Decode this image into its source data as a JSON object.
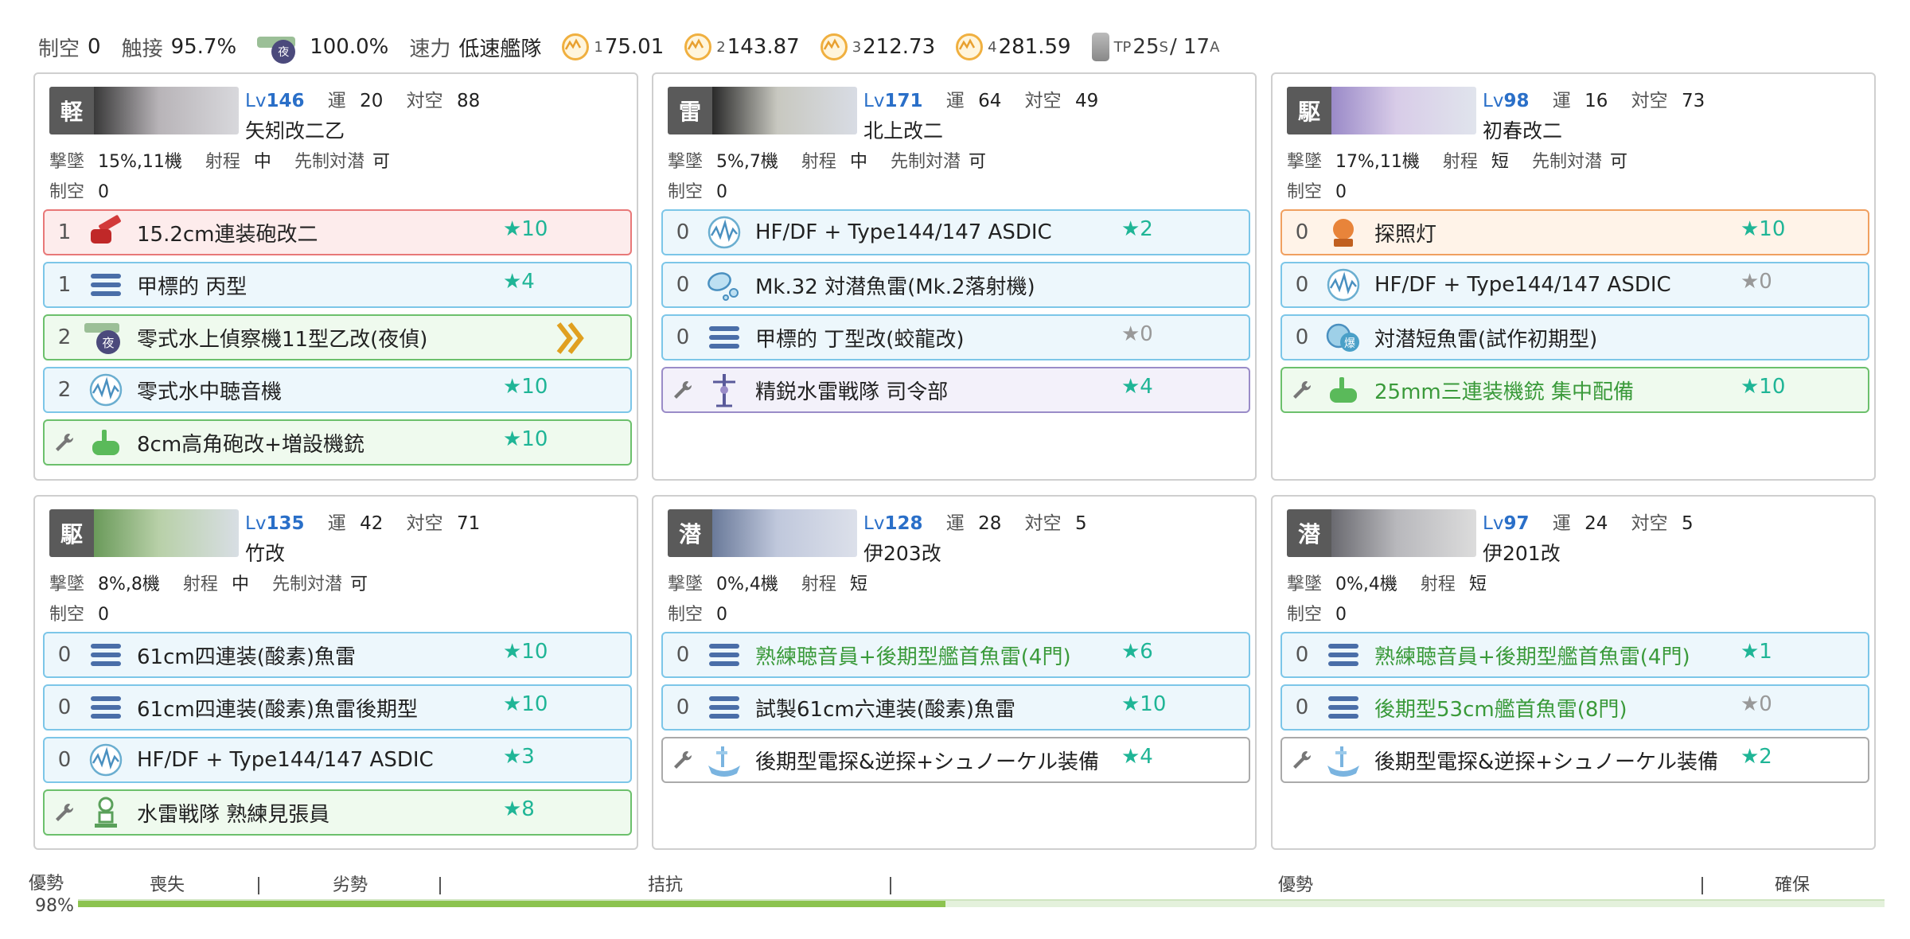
{
  "topbar": {
    "seiku_label": "制空",
    "seiku_value": "0",
    "shokusetsu_label": "触接",
    "shokusetsu_value": "95.7%",
    "night_icon": "夜",
    "night_value": "100.0%",
    "speed_label": "速力",
    "speed_value": "低速艦隊",
    "los": [
      {
        "sub": "1",
        "value": "75.01"
      },
      {
        "sub": "2",
        "value": "143.87"
      },
      {
        "sub": "3",
        "value": "212.73"
      },
      {
        "sub": "4",
        "value": "281.59"
      }
    ],
    "tp_sub": "TP",
    "tp_s": "25",
    "tp_s_sub": "S",
    "tp_sep": "/ 17",
    "tp_a_sub": "A"
  },
  "labels": {
    "luck": "運",
    "aa": "対空",
    "shootdown": "撃墜",
    "range": "射程",
    "oasw": "先制対潜",
    "air": "制空"
  },
  "ships": [
    {
      "type": "軽",
      "lv_prefix": "Lv",
      "lv": "146",
      "luck": "20",
      "aa": "88",
      "name": "矢矧改二乙",
      "shootdown": "15%,11機",
      "range": "中",
      "oasw": "可",
      "air": "0",
      "slots": [
        {
          "num": "1",
          "name": "15.2cm連装砲改二",
          "star": "★10"
        },
        {
          "num": "1",
          "name": "甲標的 丙型",
          "star": "★4"
        },
        {
          "num": "2",
          "name": "零式水上偵察機11型乙改(夜偵)",
          "star": ""
        },
        {
          "num": "2",
          "name": "零式水中聴音機",
          "star": "★10"
        },
        {
          "num": "",
          "name": "8cm高角砲改+増設機銃",
          "star": "★10"
        }
      ]
    },
    {
      "type": "雷",
      "lv_prefix": "Lv",
      "lv": "171",
      "luck": "64",
      "aa": "49",
      "name": "北上改二",
      "shootdown": "5%,7機",
      "range": "中",
      "oasw": "可",
      "air": "0",
      "slots": [
        {
          "num": "0",
          "name": "HF/DF + Type144/147 ASDIC",
          "star": "★2"
        },
        {
          "num": "0",
          "name": "Mk.32 対潜魚雷(Mk.2落射機)",
          "star": ""
        },
        {
          "num": "0",
          "name": "甲標的 丁型改(蛟龍改)",
          "star": "★0"
        },
        {
          "num": "",
          "name": "精鋭水雷戦隊 司令部",
          "star": "★4"
        }
      ]
    },
    {
      "type": "駆",
      "lv_prefix": "Lv",
      "lv": "98",
      "luck": "16",
      "aa": "73",
      "name": "初春改二",
      "shootdown": "17%,11機",
      "range": "短",
      "oasw": "可",
      "air": "0",
      "slots": [
        {
          "num": "0",
          "name": "探照灯",
          "star": "★10"
        },
        {
          "num": "0",
          "name": "HF/DF + Type144/147 ASDIC",
          "star": "★0"
        },
        {
          "num": "0",
          "name": "対潜短魚雷(試作初期型)",
          "star": ""
        },
        {
          "num": "",
          "name": "25mm三連装機銃 集中配備",
          "star": "★10"
        }
      ]
    },
    {
      "type": "駆",
      "lv_prefix": "Lv",
      "lv": "135",
      "luck": "42",
      "aa": "71",
      "name": "竹改",
      "shootdown": "8%,8機",
      "range": "中",
      "oasw": "可",
      "air": "0",
      "slots": [
        {
          "num": "0",
          "name": "61cm四連装(酸素)魚雷",
          "star": "★10"
        },
        {
          "num": "0",
          "name": "61cm四連装(酸素)魚雷後期型",
          "star": "★10"
        },
        {
          "num": "0",
          "name": "HF/DF + Type144/147 ASDIC",
          "star": "★3"
        },
        {
          "num": "",
          "name": "水雷戦隊 熟練見張員",
          "star": "★8"
        }
      ]
    },
    {
      "type": "潜",
      "lv_prefix": "Lv",
      "lv": "128",
      "luck": "28",
      "aa": "5",
      "name": "伊203改",
      "shootdown": "0%,4機",
      "range": "短",
      "oasw": "",
      "air": "0",
      "slots": [
        {
          "num": "0",
          "name": "熟練聴音員+後期型艦首魚雷(4門)",
          "star": "★6"
        },
        {
          "num": "0",
          "name": "試製61cm六連装(酸素)魚雷",
          "star": "★10"
        },
        {
          "num": "",
          "name": "後期型電探&逆探+シュノーケル装備",
          "star": "★4"
        }
      ]
    },
    {
      "type": "潜",
      "lv_prefix": "Lv",
      "lv": "97",
      "luck": "24",
      "aa": "5",
      "name": "伊201改",
      "shootdown": "0%,4機",
      "range": "短",
      "oasw": "",
      "air": "0",
      "slots": [
        {
          "num": "0",
          "name": "熟練聴音員+後期型艦首魚雷(4門)",
          "star": "★1"
        },
        {
          "num": "0",
          "name": "後期型53cm艦首魚雷(8門)",
          "star": "★0"
        },
        {
          "num": "",
          "name": "後期型電探&逆探+シュノーケル装備",
          "star": "★2"
        }
      ]
    }
  ],
  "airbar": {
    "state": "優勢",
    "percent": "98%",
    "fill_percent": 48,
    "segments": [
      "喪失",
      "劣勢",
      "拮抗",
      "優勢",
      "確保"
    ]
  },
  "colors": {
    "accent_blue": "#2a6fc8",
    "star_teal": "#1fb596",
    "air_fill": "#8cc34f"
  }
}
